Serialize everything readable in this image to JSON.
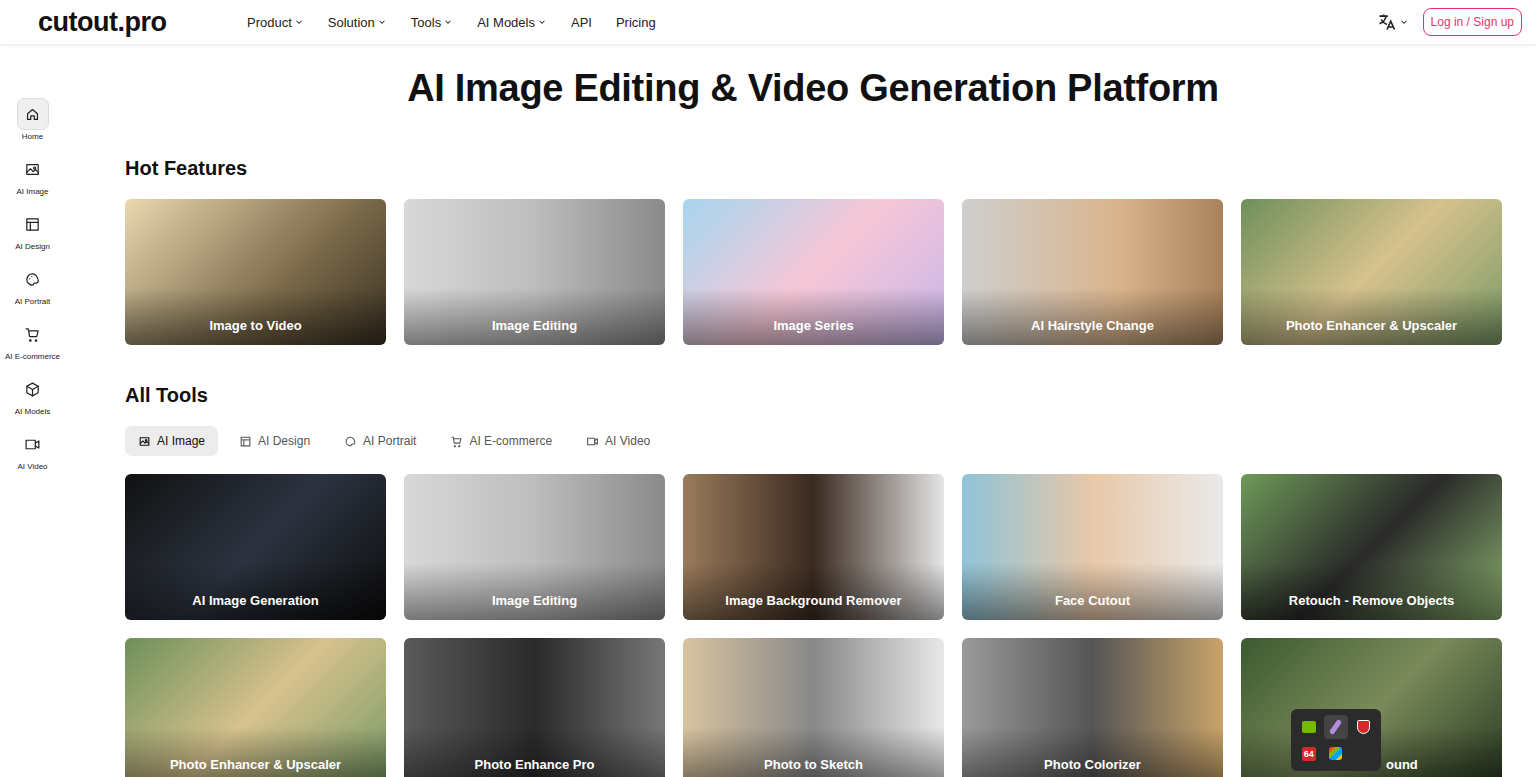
{
  "header": {
    "logo": "cutout.pro",
    "nav": [
      {
        "label": "Product",
        "dropdown": true
      },
      {
        "label": "Solution",
        "dropdown": true
      },
      {
        "label": "Tools",
        "dropdown": true
      },
      {
        "label": "AI Models",
        "dropdown": true
      },
      {
        "label": "API",
        "dropdown": false
      },
      {
        "label": "Pricing",
        "dropdown": false
      }
    ],
    "login": "Log in / Sign up"
  },
  "sidebar": {
    "items": [
      {
        "label": "Home",
        "selected": true
      },
      {
        "label": "AI Image",
        "selected": false
      },
      {
        "label": "AI Design",
        "selected": false
      },
      {
        "label": "AI Portrait",
        "selected": false
      },
      {
        "label": "AI E-commerce",
        "selected": false
      },
      {
        "label": "AI Models",
        "selected": false
      },
      {
        "label": "AI Video",
        "selected": false
      }
    ]
  },
  "title": "AI Image Editing & Video Generation Platform",
  "hot": {
    "heading": "Hot Features",
    "cards": [
      {
        "label": "Image to Video"
      },
      {
        "label": "Image Editing"
      },
      {
        "label": "Image Series"
      },
      {
        "label": "AI Hairstyle Change"
      },
      {
        "label": "Photo Enhancer & Upscaler"
      }
    ]
  },
  "tools": {
    "heading": "All Tools",
    "tabs": [
      {
        "label": "AI Image",
        "selected": true
      },
      {
        "label": "AI Design",
        "selected": false
      },
      {
        "label": "AI Portrait",
        "selected": false
      },
      {
        "label": "AI E-commerce",
        "selected": false
      },
      {
        "label": "AI Video",
        "selected": false
      }
    ],
    "cards": [
      {
        "label": "AI Image Generation"
      },
      {
        "label": "Image Editing"
      },
      {
        "label": "Image Background Remover"
      },
      {
        "label": "Face Cutout"
      },
      {
        "label": "Retouch - Remove Objects"
      },
      {
        "label": "Photo Enhancer & Upscaler"
      },
      {
        "label": "Photo Enhance Pro"
      },
      {
        "label": "Photo to Sketch"
      },
      {
        "label": "Photo Colorizer"
      },
      {
        "label": "ound"
      }
    ]
  },
  "tray": {
    "badge": "64"
  }
}
